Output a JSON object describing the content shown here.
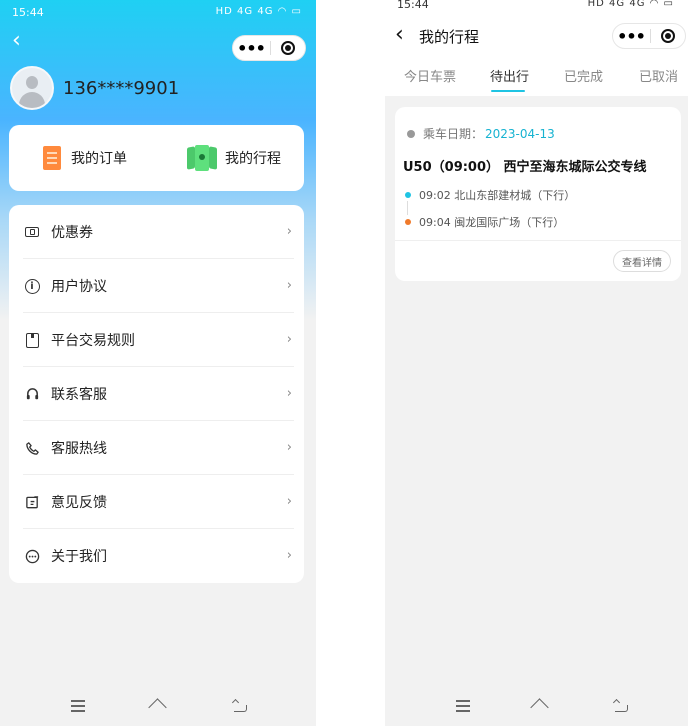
{
  "left": {
    "status_time": "15:44",
    "status_icons": "HD 4G 4G ◠ ▭",
    "phone_number": "136****9901",
    "quick_actions": [
      {
        "label": "我的订单",
        "icon": "order-icon"
      },
      {
        "label": "我的行程",
        "icon": "trip-ticket-icon"
      }
    ],
    "menu_items": [
      {
        "label": "优惠券",
        "icon": "coupon-icon"
      },
      {
        "label": "用户协议",
        "icon": "info-icon"
      },
      {
        "label": "平台交易规则",
        "icon": "bookmark-icon"
      },
      {
        "label": "联系客服",
        "icon": "headset-icon"
      },
      {
        "label": "客服热线",
        "icon": "phone-icon"
      },
      {
        "label": "意见反馈",
        "icon": "edit-icon"
      },
      {
        "label": "关于我们",
        "icon": "more-circle-icon"
      }
    ],
    "chevron": "›"
  },
  "right": {
    "status_time": "15:44",
    "status_icons": "HD 4G 4G ◠ ▭",
    "title": "我的行程",
    "tabs": [
      {
        "label": "今日车票",
        "active": false
      },
      {
        "label": "待出行",
        "active": true
      },
      {
        "label": "已完成",
        "active": false
      },
      {
        "label": "已取消",
        "active": false
      }
    ],
    "trip": {
      "date_label": "乘车日期：",
      "date_value": "2023-04-13",
      "route": "U50（09:00） 西宁至海东城际公交专线",
      "stops": [
        {
          "text": "09:02  北山东部建材城（下行）",
          "color": "#1fc4e3"
        },
        {
          "text": "09:04  闽龙国际广场（下行）",
          "color": "#f07a2a"
        }
      ],
      "detail_button": "查看详情"
    }
  },
  "colors": {
    "accent": "#1fc4e3",
    "brand_gradient_top": "#1fd0f3",
    "orange": "#f07a2a"
  }
}
